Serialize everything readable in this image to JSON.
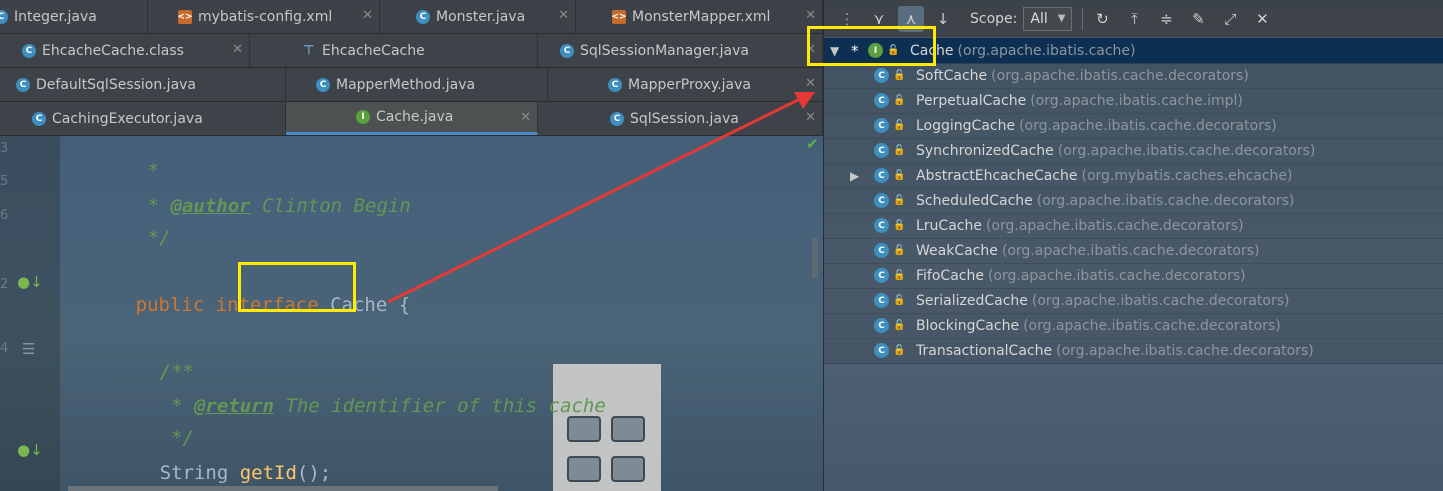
{
  "tabs": {
    "row1": [
      {
        "label": "Integer.java",
        "icon": "class"
      },
      {
        "label": "mybatis-config.xml",
        "icon": "xml"
      },
      {
        "label": "Monster.java",
        "icon": "class"
      },
      {
        "label": "MonsterMapper.xml",
        "icon": "xml"
      }
    ],
    "row2": [
      {
        "label": "EhcacheCache.class",
        "icon": "class"
      },
      {
        "label": "EhcacheCache",
        "icon": "structure"
      },
      {
        "label": "SqlSessionManager.java",
        "icon": "class"
      }
    ],
    "row3": [
      {
        "label": "DefaultSqlSession.java",
        "icon": "class"
      },
      {
        "label": "MapperMethod.java",
        "icon": "class"
      },
      {
        "label": "MapperProxy.java",
        "icon": "class"
      }
    ],
    "row4": [
      {
        "label": "CachingExecutor.java",
        "icon": "class"
      },
      {
        "label": "Cache.java",
        "icon": "interface",
        "active": true
      },
      {
        "label": "SqlSession.java",
        "icon": "class"
      }
    ]
  },
  "editor": {
    "line_numbers": [
      "3",
      "5",
      "6",
      "",
      "2",
      "",
      "4",
      "",
      "",
      ""
    ],
    "lines": {
      "c1": "*",
      "c2_star": "* ",
      "c2_tag": "@author",
      "c2_rest": " Clinton Begin",
      "c3": "*/",
      "decl_kw": "public interface ",
      "decl_name": "Cache",
      "decl_brace": " {",
      "doc_open": "/**",
      "ret_star": " * ",
      "ret_tag": "@return",
      "ret_rest": " The identifier of this cache",
      "doc_close": " */",
      "sig_type": "String ",
      "sig_fn": "getId",
      "sig_rest": "();"
    }
  },
  "hierarchy": {
    "scope_label": "Scope:",
    "scope_value": "All",
    "root": {
      "star": "*",
      "name": "Cache",
      "package": "(org.apache.ibatis.cache)"
    },
    "children": [
      {
        "name": "SoftCache",
        "package": "(org.apache.ibatis.cache.decorators)"
      },
      {
        "name": "PerpetualCache",
        "package": "(org.apache.ibatis.cache.impl)"
      },
      {
        "name": "LoggingCache",
        "package": "(org.apache.ibatis.cache.decorators)"
      },
      {
        "name": "SynchronizedCache",
        "package": "(org.apache.ibatis.cache.decorators)"
      },
      {
        "name": "AbstractEhcacheCache",
        "package": "(org.mybatis.caches.ehcache)",
        "expandable": true
      },
      {
        "name": "ScheduledCache",
        "package": "(org.apache.ibatis.cache.decorators)"
      },
      {
        "name": "LruCache",
        "package": "(org.apache.ibatis.cache.decorators)"
      },
      {
        "name": "WeakCache",
        "package": "(org.apache.ibatis.cache.decorators)"
      },
      {
        "name": "FifoCache",
        "package": "(org.apache.ibatis.cache.decorators)"
      },
      {
        "name": "SerializedCache",
        "package": "(org.apache.ibatis.cache.decorators)"
      },
      {
        "name": "BlockingCache",
        "package": "(org.apache.ibatis.cache.decorators)"
      },
      {
        "name": "TransactionalCache",
        "package": "(org.apache.ibatis.cache.decorators)"
      }
    ]
  },
  "colors": {
    "highlight": "#ffea00",
    "annotation_arrow": "#e53935",
    "keyword": "#cc7832",
    "comment": "#629755",
    "method": "#ffc66d"
  }
}
